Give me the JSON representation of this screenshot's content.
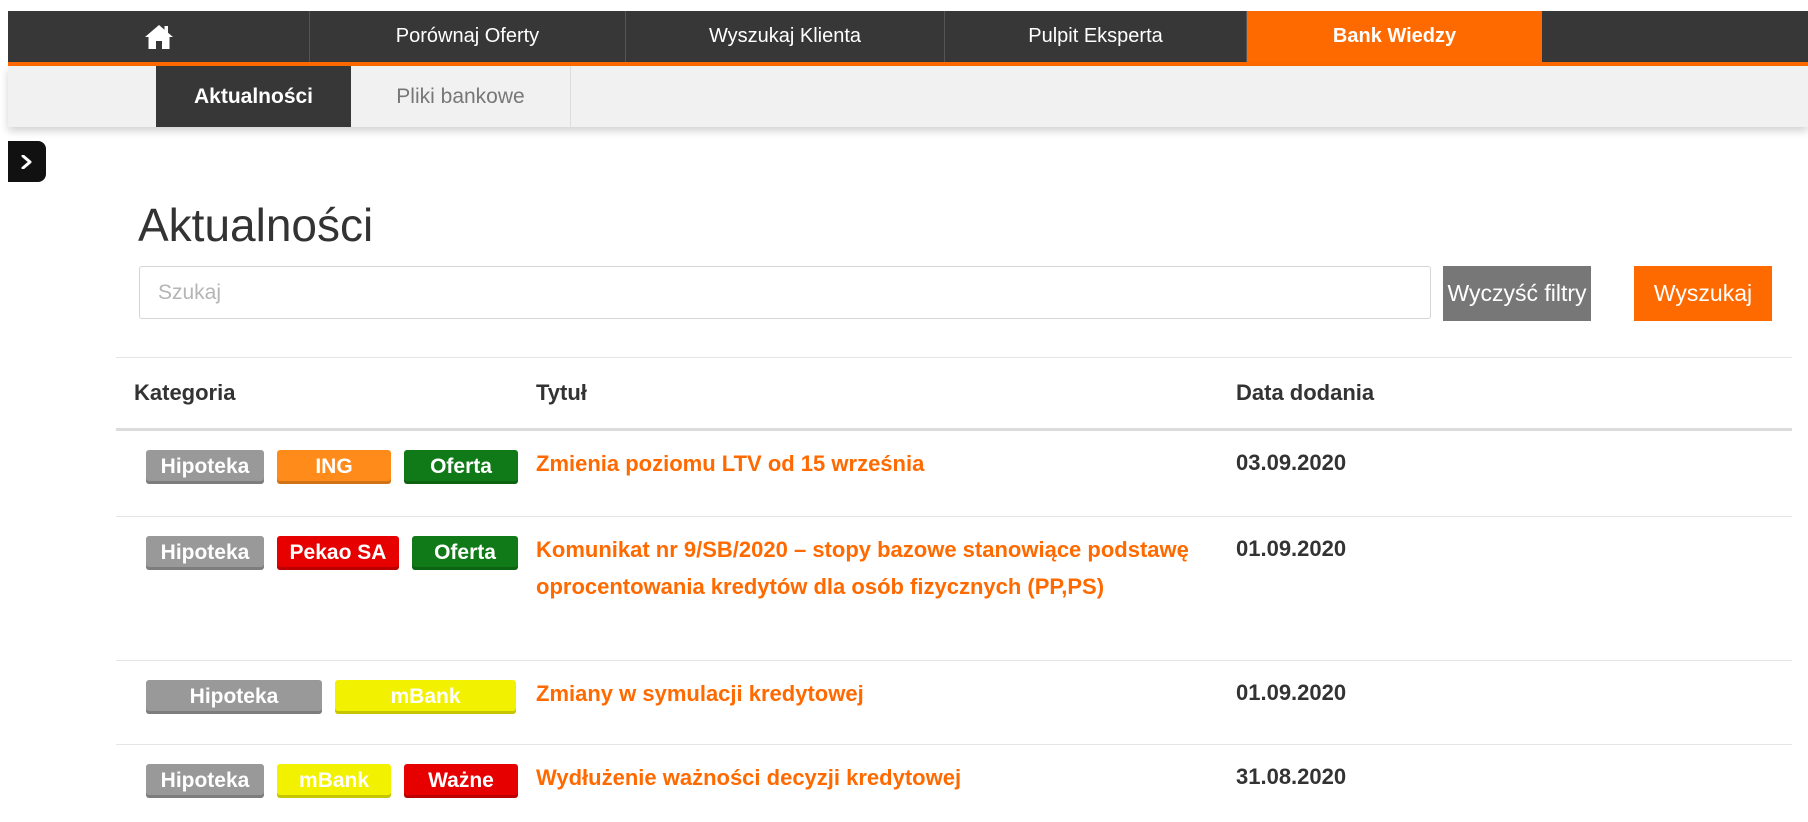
{
  "nav": {
    "home_icon": "home-icon",
    "items": [
      {
        "label": "Porównaj Oferty"
      },
      {
        "label": "Wyszukaj Klienta"
      },
      {
        "label": "Pulpit Eksperta"
      },
      {
        "label": "Bank Wiedzy",
        "active": true
      }
    ]
  },
  "subnav": {
    "items": [
      {
        "label": "Aktualności",
        "active": true
      },
      {
        "label": "Pliki bankowe"
      }
    ]
  },
  "sidebar_toggle_icon": "chevron-right-icon",
  "page": {
    "title": "Aktualności",
    "search_placeholder": "Szukaj",
    "clear_label": "Wyczyść filtry",
    "search_label": "Wyszukaj"
  },
  "table": {
    "headers": [
      "Kategoria",
      "Tytuł",
      "Data dodania"
    ],
    "rows": [
      {
        "badges": [
          {
            "label": "Hipoteka",
            "color": "#999999"
          },
          {
            "label": "ING",
            "color": "#ff8c1a"
          },
          {
            "label": "Oferta",
            "color": "#0f7a17"
          }
        ],
        "title": "Zmienia poziomu LTV od 15 września",
        "date": "03.09.2020"
      },
      {
        "badges": [
          {
            "label": "Hipoteka",
            "color": "#999999"
          },
          {
            "label": "Pekao SA",
            "color": "#e60000"
          },
          {
            "label": "Oferta",
            "color": "#0f7a17"
          }
        ],
        "title": "Komunikat nr 9/SB/2020 – stopy bazowe stanowiące podstawę oprocentowania kredytów dla osób fizycznych (PP,PS)",
        "date": "01.09.2020"
      },
      {
        "badges": [
          {
            "label": "Hipoteka",
            "color": "#999999"
          },
          {
            "label": "mBank",
            "color": "#f2f200"
          }
        ],
        "title": "Zmiany w symulacji kredytowej",
        "date": "01.09.2020"
      },
      {
        "badges": [
          {
            "label": "Hipoteka",
            "color": "#999999"
          },
          {
            "label": "mBank",
            "color": "#f2f200"
          },
          {
            "label": "Ważne",
            "color": "#e60000"
          }
        ],
        "title": "Wydłużenie ważności decyzji kredytowej",
        "date": "31.08.2020"
      }
    ]
  },
  "colors": {
    "accent": "#ff6a00",
    "nav_bg": "#373737"
  }
}
